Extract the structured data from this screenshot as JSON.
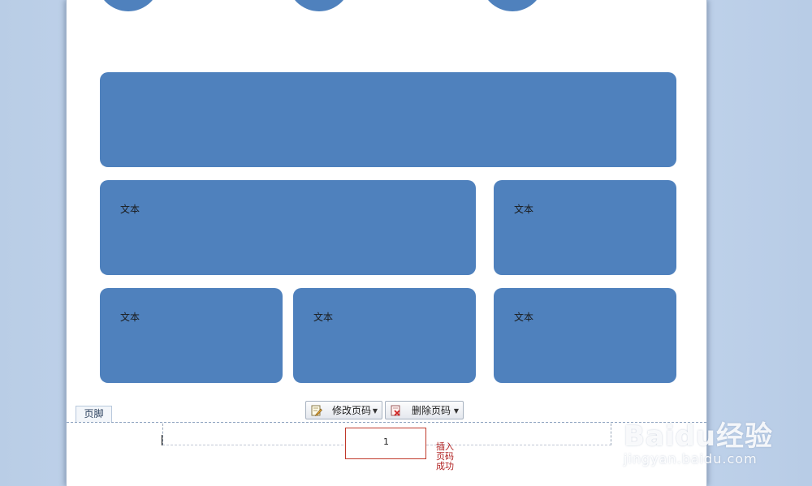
{
  "document": {
    "shapes": {
      "boxes": [
        {
          "label": ""
        },
        {
          "label": "文本"
        },
        {
          "label": "文本"
        },
        {
          "label": "文本"
        },
        {
          "label": "文本"
        },
        {
          "label": "文本"
        }
      ]
    },
    "footer": {
      "tag": "页脚",
      "page_number": "1"
    },
    "annotation": "插入页码成功"
  },
  "footer_toolbar": {
    "edit_page_number": "修改页码",
    "delete_page_number": "删除页码"
  },
  "watermark": {
    "brand": "Baidu经验",
    "url": "jingyan.baidu.com"
  },
  "colors": {
    "shape_fill": "#4f81bd",
    "annotation_red": "#b02020"
  }
}
